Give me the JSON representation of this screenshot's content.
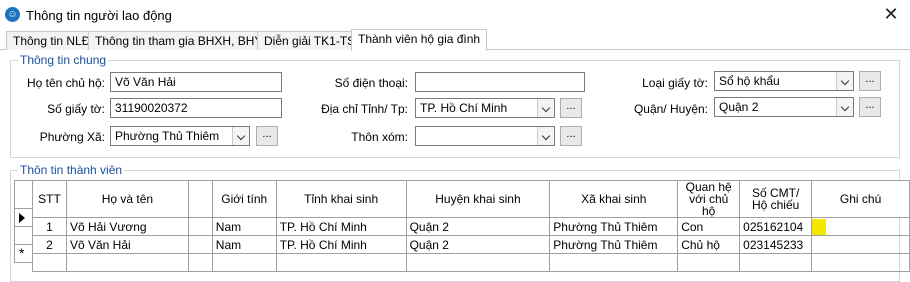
{
  "window": {
    "title": "Thông tin người lao động",
    "close_label": "✕"
  },
  "tabs": [
    {
      "label": "Thông tin NLĐ"
    },
    {
      "label": "Thông tin tham gia BHXH, BHYT"
    },
    {
      "label": "Diễn giải TK1-TS"
    },
    {
      "label": "Thành viên hộ gia đình"
    }
  ],
  "general": {
    "title": "Thông tin chung",
    "owner_name_label": "Họ tên chủ hộ:",
    "owner_name": "Võ Văn Hải",
    "phone_label": "Số điện thoại:",
    "phone": "",
    "doc_type_label": "Loại giấy tờ:",
    "doc_type": "Sổ hộ khẩu",
    "doc_no_label": "Số giấy tờ:",
    "doc_no": "31190020372",
    "province_label": "Địa chỉ Tỉnh/ Tp:",
    "province": "TP. Hồ Chí Minh",
    "district_label": "Quận/ Huyện:",
    "district": "Quận 2",
    "ward_label": "Phường Xã:",
    "ward": "Phường Thủ Thiêm",
    "hamlet_label": "Thôn xóm:",
    "hamlet": "",
    "ellipsis": "..."
  },
  "members": {
    "title": "Thôn tin thành viên",
    "columns": [
      "STT",
      "Họ và tên",
      "",
      "Giới tính",
      "Tỉnh khai sinh",
      "Huyện khai sinh",
      "Xã khai sinh",
      "Quan hệ với chủ hộ",
      "Số CMT/ Hộ chiếu",
      "Ghi chú"
    ],
    "rows": [
      [
        "1",
        "Võ Hải Vương",
        "",
        "Nam",
        "TP. Hồ Chí Minh",
        "Quận 2",
        "Phường Thủ Thiêm",
        "Con",
        "025162104",
        ""
      ],
      [
        "2",
        "Võ Văn Hải",
        "",
        "Nam",
        "TP. Hồ Chí Minh",
        "Quận 2",
        "Phường Thủ Thiêm",
        "Chủ hộ",
        "023145233",
        ""
      ]
    ],
    "new_row_marker": "*",
    "highlight_color": "#f5e700"
  }
}
